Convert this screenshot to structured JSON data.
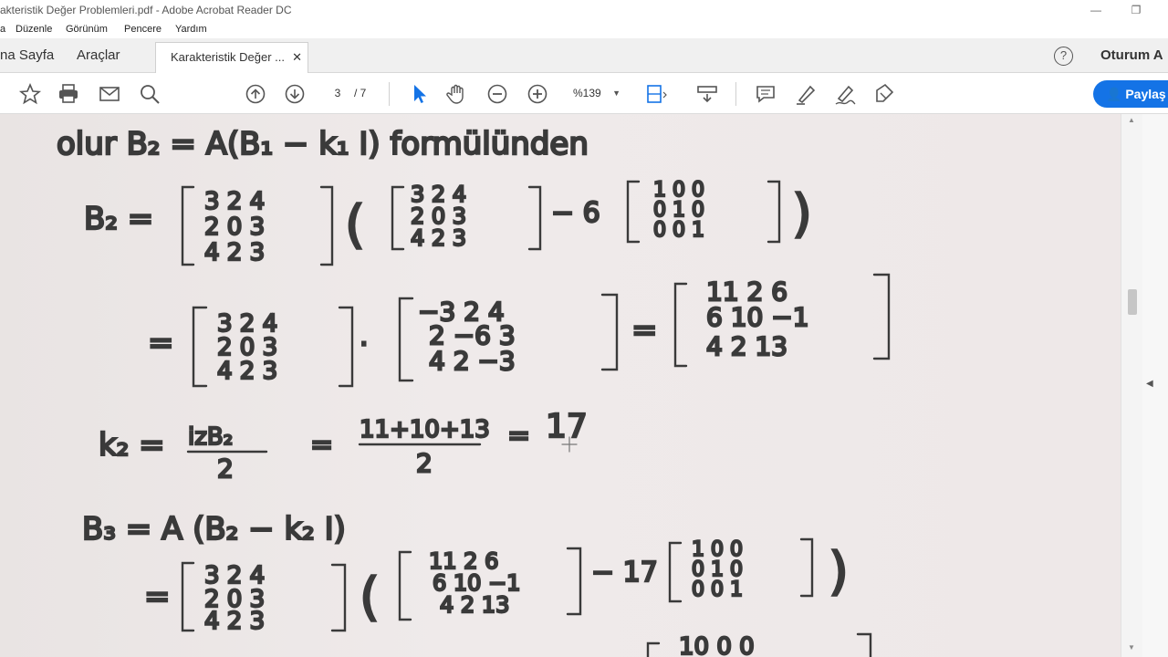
{
  "window": {
    "title": "akteristik Değer Problemleri.pdf - Adobe Acrobat Reader DC"
  },
  "menu": {
    "items": [
      "a",
      "Düzenle",
      "Görünüm",
      "Pencere",
      "Yardım"
    ]
  },
  "tabs": {
    "home": "na Sayfa",
    "tools": "Araçlar",
    "document": "Karakteristik Değer ...",
    "close": "✕"
  },
  "header": {
    "help": "?",
    "signin": "Oturum A"
  },
  "toolbar": {
    "page_current": "3",
    "page_total": "/ 7",
    "zoom": "%139",
    "share_label": "Paylaş"
  },
  "colors": {
    "accent": "#1473e6",
    "paper": "#ece7e6",
    "ink": "#3a3a3a"
  },
  "document": {
    "lines": [
      "olur  B₂ = A(B₁ − k₁ I)   formülünden",
      "B₂ = [3 2 4; 2 0 3; 4 2 3] ( [3 2 4; 2 0 3; 4 2 3] − 6 [1 0 0; 0 1 0; 0 0 1] )",
      "= [3 2 4; 2 0 3; 4 2 3] · [−3 2 4; 2 −6 3; 4 2 −3] = [11 2 6; 6 10 −1; 4 2 13]",
      "k₂ = izB₂ / 2 = (11+10+13) / 2 = 17",
      "B₃ = A (B₂ − k₂ I)",
      "= [3 2 4; 2 0 3; 4 2 3] ( [11 2 6; 6 10 −1; 4 2 13] − 17 [1 0 0; 0 1 0; 0 0 1] )"
    ]
  }
}
